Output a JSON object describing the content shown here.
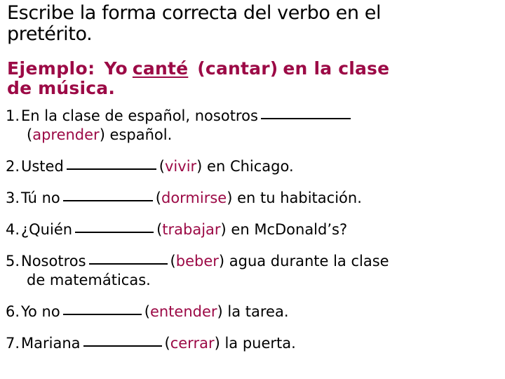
{
  "colors": {
    "accent_maroon": "#9c0a46",
    "text_black": "#000000",
    "background": "#ffffff"
  },
  "title": {
    "line1": "Escribe la forma correcta del verbo en el",
    "line2": "pretérito."
  },
  "example": {
    "label": "Ejemplo:",
    "subject": "Yo",
    "answer": "canté",
    "verb_paren": "(cantar)",
    "tail": "en la clase",
    "line2": "de música."
  },
  "exercises": [
    {
      "number": "1.",
      "before": "En la clase de español, nosotros",
      "blank": "______",
      "blank_size": "b-long",
      "continuation_before": "(",
      "verb": "aprender",
      "continuation_after": ") español.",
      "two_line": true,
      "after": ""
    },
    {
      "number": "2.",
      "before": "Usted",
      "blank": "______",
      "blank_size": "b-long",
      "verb": "vivir",
      "after": ") en Chicago.",
      "open_paren": "(",
      "two_line": false
    },
    {
      "number": "3.",
      "before": "Tú no",
      "blank": "______",
      "blank_size": "b-long",
      "verb": "dormirse",
      "after": ") en tu habitación.",
      "open_paren": "(",
      "two_line": false
    },
    {
      "number": "4.",
      "before": "¿Quién",
      "blank": "______",
      "blank_size": "b-med",
      "verb": "trabajar",
      "after": ") en McDonald’s?",
      "open_paren": "(",
      "two_line": false
    },
    {
      "number": "5.",
      "before": "Nosotros",
      "blank": "______",
      "blank_size": "b-med",
      "verb": "beber",
      "after": ") agua durante la clase",
      "open_paren": "(",
      "two_line": true,
      "continuation_line": "de matemáticas."
    },
    {
      "number": "6.",
      "before": "Yo no",
      "blank": "______",
      "blank_size": "b-med",
      "verb": "entender",
      "after": ") la tarea.",
      "open_paren": "(",
      "two_line": false
    },
    {
      "number": "7.",
      "before": "Mariana",
      "blank": "______",
      "blank_size": "b-med",
      "verb": "cerrar",
      "after": ") la puerta.",
      "open_paren": "(",
      "two_line": false
    }
  ]
}
